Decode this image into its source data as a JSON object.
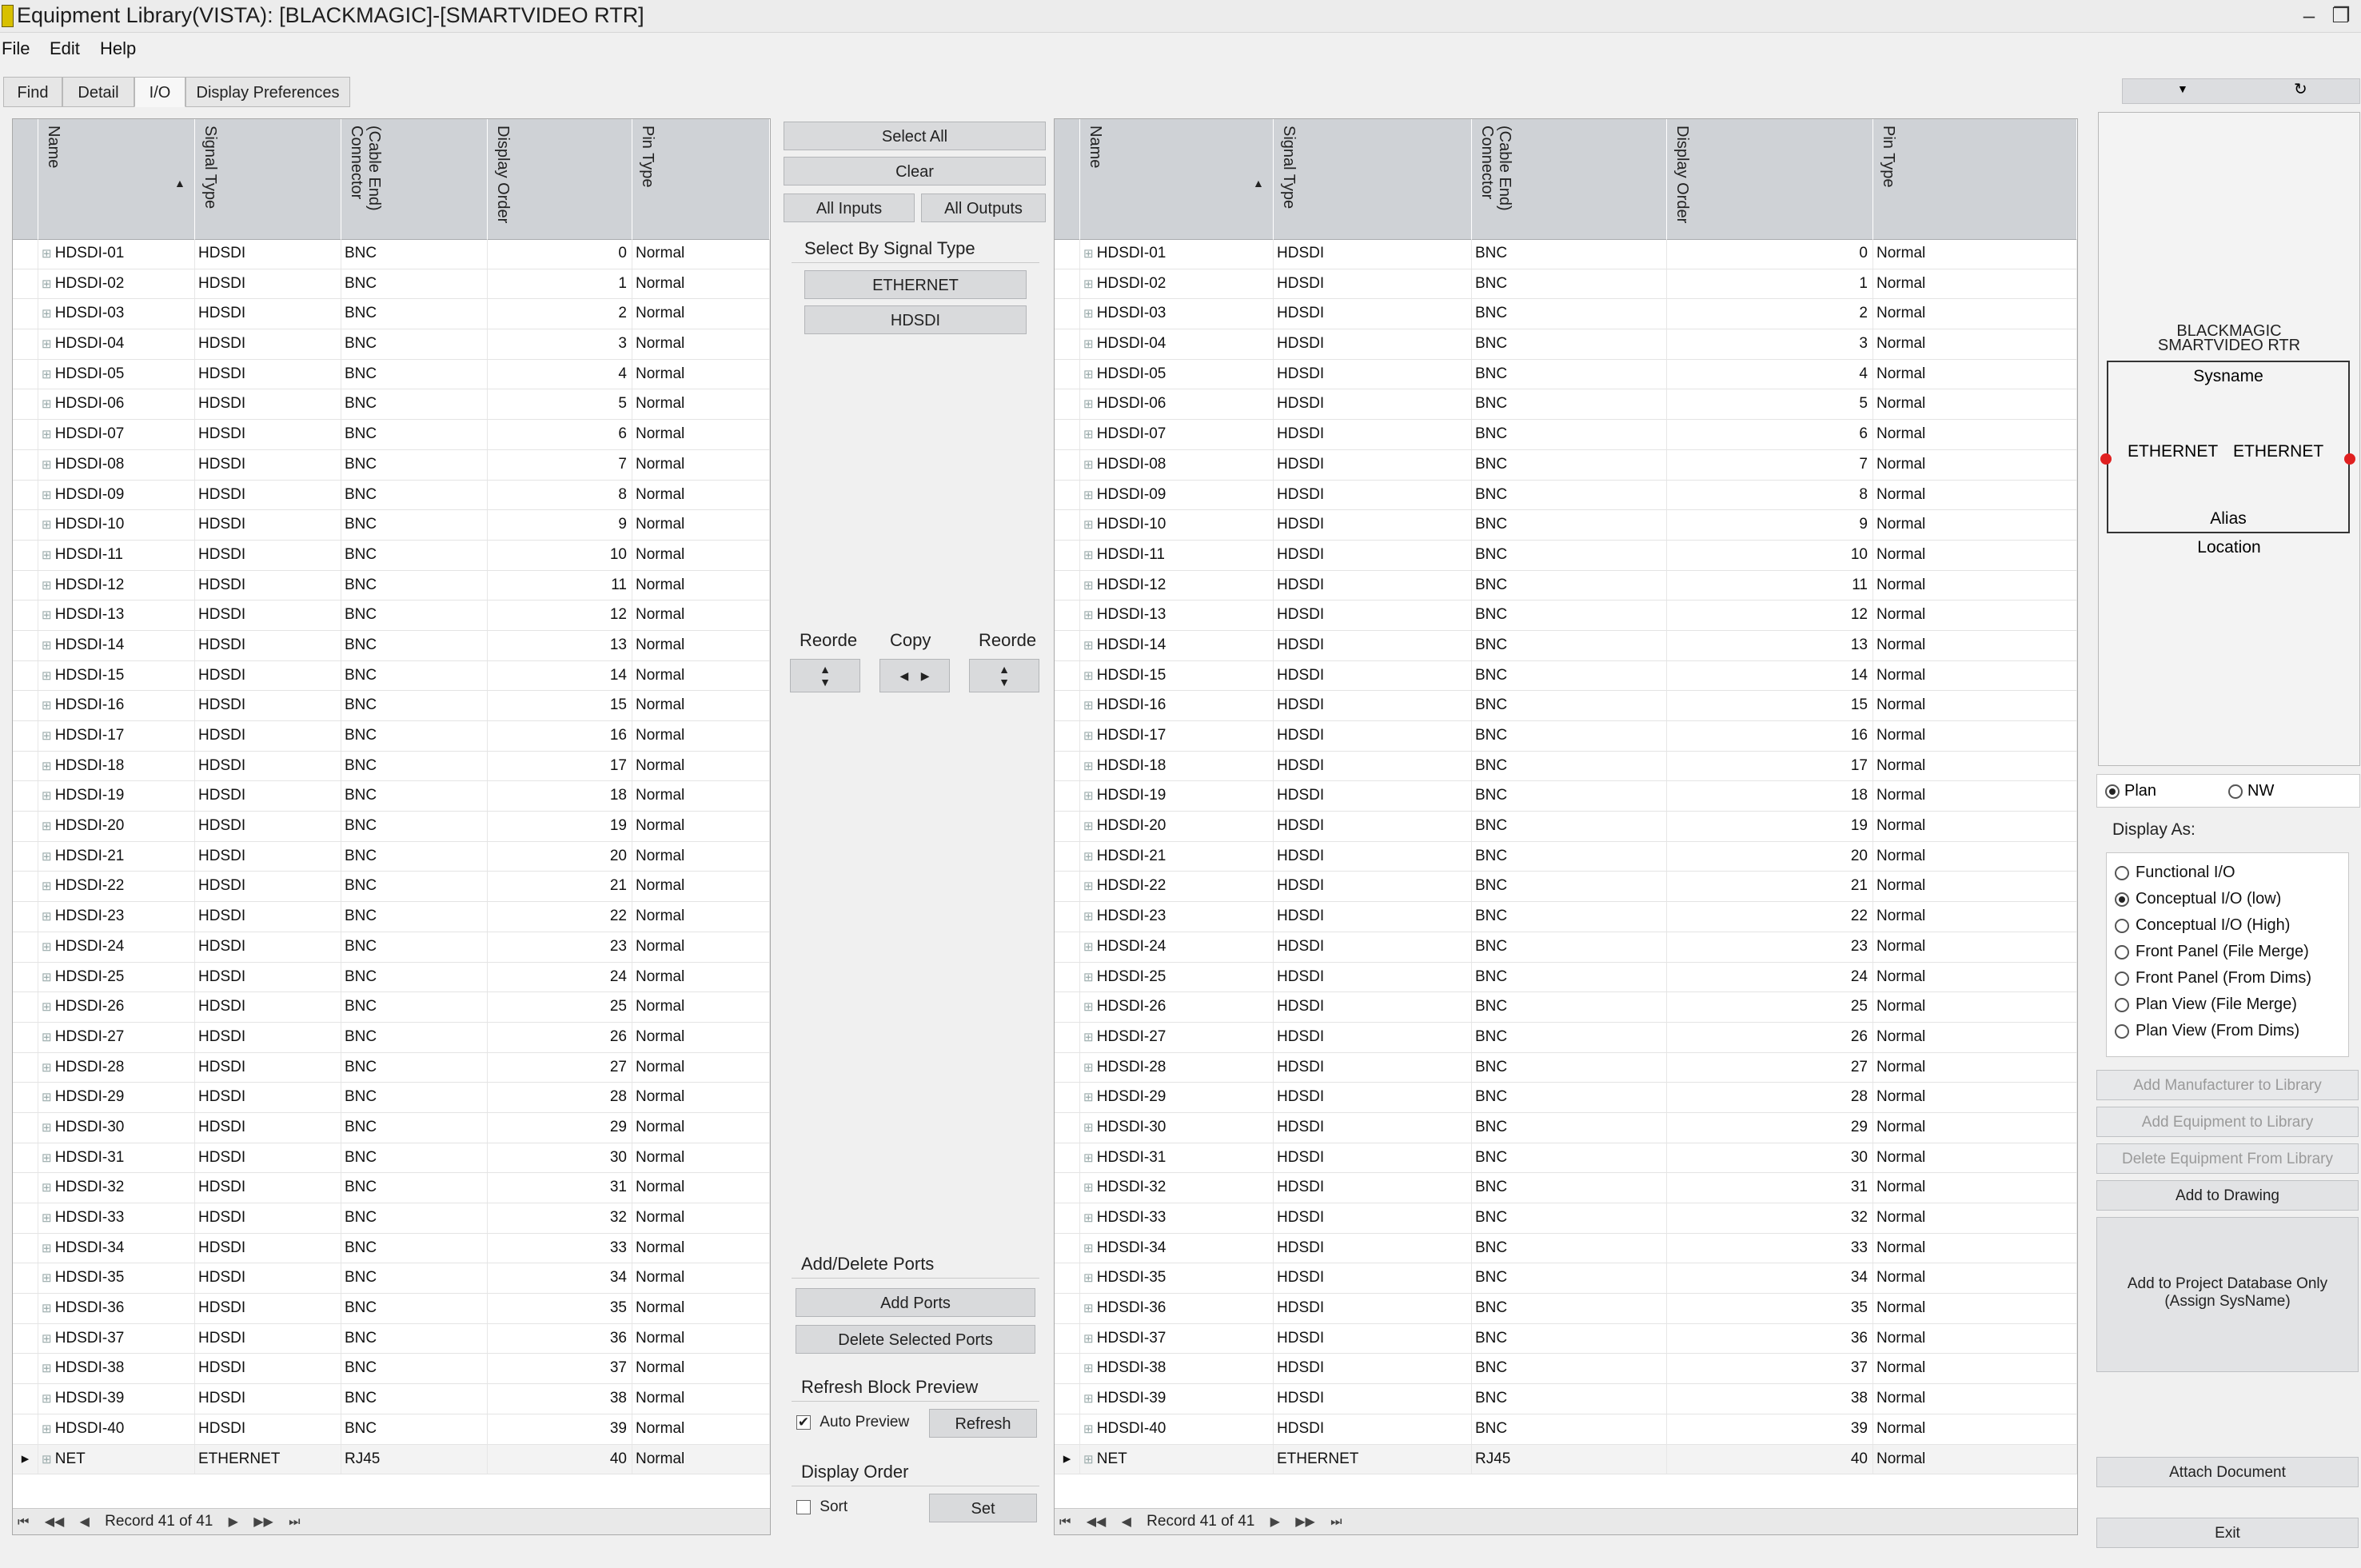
{
  "window": {
    "title": "Equipment Library(VISTA): [BLACKMAGIC]-[SMARTVIDEO RTR]",
    "minimize": "–",
    "restore": "❐"
  },
  "menu": [
    "File",
    "Edit",
    "Help"
  ],
  "tabs": [
    "Find",
    "Detail",
    "I/O",
    "Display Preferences"
  ],
  "grid": {
    "headers": [
      "Name",
      "Signal Type",
      "(Cable End)\nConnector",
      "Display Order",
      "Pin Type"
    ],
    "sort_indicator": "▲",
    "rows": [
      {
        "name": "HDSDI-01",
        "signal": "HDSDI",
        "connector": "BNC",
        "order": "0",
        "pin": "Normal"
      },
      {
        "name": "HDSDI-02",
        "signal": "HDSDI",
        "connector": "BNC",
        "order": "1",
        "pin": "Normal"
      },
      {
        "name": "HDSDI-03",
        "signal": "HDSDI",
        "connector": "BNC",
        "order": "2",
        "pin": "Normal"
      },
      {
        "name": "HDSDI-04",
        "signal": "HDSDI",
        "connector": "BNC",
        "order": "3",
        "pin": "Normal"
      },
      {
        "name": "HDSDI-05",
        "signal": "HDSDI",
        "connector": "BNC",
        "order": "4",
        "pin": "Normal"
      },
      {
        "name": "HDSDI-06",
        "signal": "HDSDI",
        "connector": "BNC",
        "order": "5",
        "pin": "Normal"
      },
      {
        "name": "HDSDI-07",
        "signal": "HDSDI",
        "connector": "BNC",
        "order": "6",
        "pin": "Normal"
      },
      {
        "name": "HDSDI-08",
        "signal": "HDSDI",
        "connector": "BNC",
        "order": "7",
        "pin": "Normal"
      },
      {
        "name": "HDSDI-09",
        "signal": "HDSDI",
        "connector": "BNC",
        "order": "8",
        "pin": "Normal"
      },
      {
        "name": "HDSDI-10",
        "signal": "HDSDI",
        "connector": "BNC",
        "order": "9",
        "pin": "Normal"
      },
      {
        "name": "HDSDI-11",
        "signal": "HDSDI",
        "connector": "BNC",
        "order": "10",
        "pin": "Normal"
      },
      {
        "name": "HDSDI-12",
        "signal": "HDSDI",
        "connector": "BNC",
        "order": "11",
        "pin": "Normal"
      },
      {
        "name": "HDSDI-13",
        "signal": "HDSDI",
        "connector": "BNC",
        "order": "12",
        "pin": "Normal"
      },
      {
        "name": "HDSDI-14",
        "signal": "HDSDI",
        "connector": "BNC",
        "order": "13",
        "pin": "Normal"
      },
      {
        "name": "HDSDI-15",
        "signal": "HDSDI",
        "connector": "BNC",
        "order": "14",
        "pin": "Normal"
      },
      {
        "name": "HDSDI-16",
        "signal": "HDSDI",
        "connector": "BNC",
        "order": "15",
        "pin": "Normal"
      },
      {
        "name": "HDSDI-17",
        "signal": "HDSDI",
        "connector": "BNC",
        "order": "16",
        "pin": "Normal"
      },
      {
        "name": "HDSDI-18",
        "signal": "HDSDI",
        "connector": "BNC",
        "order": "17",
        "pin": "Normal"
      },
      {
        "name": "HDSDI-19",
        "signal": "HDSDI",
        "connector": "BNC",
        "order": "18",
        "pin": "Normal"
      },
      {
        "name": "HDSDI-20",
        "signal": "HDSDI",
        "connector": "BNC",
        "order": "19",
        "pin": "Normal"
      },
      {
        "name": "HDSDI-21",
        "signal": "HDSDI",
        "connector": "BNC",
        "order": "20",
        "pin": "Normal"
      },
      {
        "name": "HDSDI-22",
        "signal": "HDSDI",
        "connector": "BNC",
        "order": "21",
        "pin": "Normal"
      },
      {
        "name": "HDSDI-23",
        "signal": "HDSDI",
        "connector": "BNC",
        "order": "22",
        "pin": "Normal"
      },
      {
        "name": "HDSDI-24",
        "signal": "HDSDI",
        "connector": "BNC",
        "order": "23",
        "pin": "Normal"
      },
      {
        "name": "HDSDI-25",
        "signal": "HDSDI",
        "connector": "BNC",
        "order": "24",
        "pin": "Normal"
      },
      {
        "name": "HDSDI-26",
        "signal": "HDSDI",
        "connector": "BNC",
        "order": "25",
        "pin": "Normal"
      },
      {
        "name": "HDSDI-27",
        "signal": "HDSDI",
        "connector": "BNC",
        "order": "26",
        "pin": "Normal"
      },
      {
        "name": "HDSDI-28",
        "signal": "HDSDI",
        "connector": "BNC",
        "order": "27",
        "pin": "Normal"
      },
      {
        "name": "HDSDI-29",
        "signal": "HDSDI",
        "connector": "BNC",
        "order": "28",
        "pin": "Normal"
      },
      {
        "name": "HDSDI-30",
        "signal": "HDSDI",
        "connector": "BNC",
        "order": "29",
        "pin": "Normal"
      },
      {
        "name": "HDSDI-31",
        "signal": "HDSDI",
        "connector": "BNC",
        "order": "30",
        "pin": "Normal"
      },
      {
        "name": "HDSDI-32",
        "signal": "HDSDI",
        "connector": "BNC",
        "order": "31",
        "pin": "Normal"
      },
      {
        "name": "HDSDI-33",
        "signal": "HDSDI",
        "connector": "BNC",
        "order": "32",
        "pin": "Normal"
      },
      {
        "name": "HDSDI-34",
        "signal": "HDSDI",
        "connector": "BNC",
        "order": "33",
        "pin": "Normal"
      },
      {
        "name": "HDSDI-35",
        "signal": "HDSDI",
        "connector": "BNC",
        "order": "34",
        "pin": "Normal"
      },
      {
        "name": "HDSDI-36",
        "signal": "HDSDI",
        "connector": "BNC",
        "order": "35",
        "pin": "Normal"
      },
      {
        "name": "HDSDI-37",
        "signal": "HDSDI",
        "connector": "BNC",
        "order": "36",
        "pin": "Normal"
      },
      {
        "name": "HDSDI-38",
        "signal": "HDSDI",
        "connector": "BNC",
        "order": "37",
        "pin": "Normal"
      },
      {
        "name": "HDSDI-39",
        "signal": "HDSDI",
        "connector": "BNC",
        "order": "38",
        "pin": "Normal"
      },
      {
        "name": "HDSDI-40",
        "signal": "HDSDI",
        "connector": "BNC",
        "order": "39",
        "pin": "Normal"
      },
      {
        "name": "NET",
        "signal": "ETHERNET",
        "connector": "RJ45",
        "order": "40",
        "pin": "Normal"
      }
    ],
    "record_text": "Record 41 of 41"
  },
  "middle": {
    "select_all": "Select All",
    "clear": "Clear",
    "all_inputs": "All Inputs",
    "all_outputs": "All Outputs",
    "select_by_signal_type": "Select By Signal Type",
    "signal_types": [
      "ETHERNET",
      "HDSDI"
    ],
    "reorder_left": "Reorde",
    "copy": "Copy",
    "reorder_right": "Reorde",
    "add_delete_ports": "Add/Delete Ports",
    "add_ports": "Add Ports",
    "delete_selected_ports": "Delete Selected Ports",
    "refresh_block_preview": "Refresh Block Preview",
    "auto_preview": "Auto Preview",
    "auto_preview_checked": true,
    "refresh": "Refresh",
    "display_order": "Display Order",
    "sort": "Sort",
    "set": "Set"
  },
  "preview": {
    "title_line1": "BLACKMAGIC",
    "title_line2": "SMARTVIDEO RTR",
    "sysname": "Sysname",
    "port_left": "ETHERNET",
    "port_right": "ETHERNET",
    "alias": "Alias",
    "location": "Location",
    "port_dot_color": "#e02020"
  },
  "view_mode": {
    "plan": "Plan",
    "nw": "NW",
    "selected": "Plan"
  },
  "display_as": {
    "label": "Display As:",
    "options": [
      "Functional I/O",
      "Conceptual I/O (low)",
      "Conceptual I/O (High)",
      "Front Panel (File Merge)",
      "Front Panel (From Dims)",
      "Plan View (File Merge)",
      "Plan View (From Dims)"
    ],
    "selected": "Conceptual I/O (low)"
  },
  "actions": {
    "add_manufacturer": "Add Manufacturer to Library",
    "add_equipment": "Add Equipment to Library",
    "delete_equipment": "Delete Equipment From Library",
    "add_to_drawing": "Add to Drawing",
    "add_to_project_line1": "Add to Project Database Only",
    "add_to_project_line2": "(Assign SysName)",
    "attach_document": "Attach Document",
    "exit": "Exit"
  }
}
